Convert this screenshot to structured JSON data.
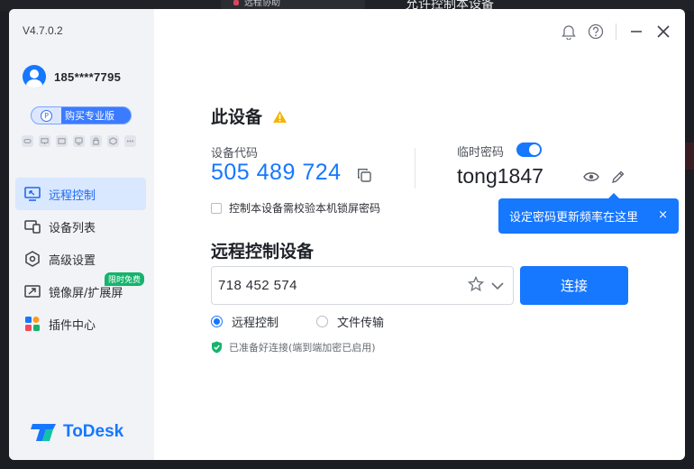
{
  "background": {
    "tab_label": "远程协助",
    "title": "允许控制本设备"
  },
  "sidebar": {
    "version": "V4.7.0.2",
    "phone": "185****7795",
    "pro_label": "购买专业版",
    "pro_icon_letter": "P",
    "items": [
      {
        "label": "远程控制",
        "icon": "monitor-remote-icon",
        "active": true
      },
      {
        "label": "设备列表",
        "icon": "devices-icon"
      },
      {
        "label": "高级设置",
        "icon": "settings-hex-icon"
      },
      {
        "label": "镜像屏/扩展屏",
        "icon": "mirror-screen-icon",
        "badge": "限时免费"
      },
      {
        "label": "插件中心",
        "icon": "plugin-grid-icon"
      }
    ],
    "logo_text": "ToDesk"
  },
  "this_device": {
    "heading": "此设备",
    "code_label": "设备代码",
    "code": "505 489 724",
    "temp_pwd_label": "临时密码",
    "temp_pwd_enabled": true,
    "password": "tong1847",
    "lock_check_label": "控制本设备需校验本机锁屏密码",
    "tooltip": "设定密码更新频率在这里",
    "tooltip_close": "×"
  },
  "remote": {
    "heading": "远程控制设备",
    "input_value": "718 452 574",
    "connect_label": "连接",
    "mode_remote": "远程控制",
    "mode_file": "文件传输",
    "selected_mode": "远程控制",
    "status": "已准备好连接(端到端加密已启用)"
  },
  "colors": {
    "accent": "#1677ff",
    "ok": "#16b36c",
    "warning": "#f5b400"
  }
}
